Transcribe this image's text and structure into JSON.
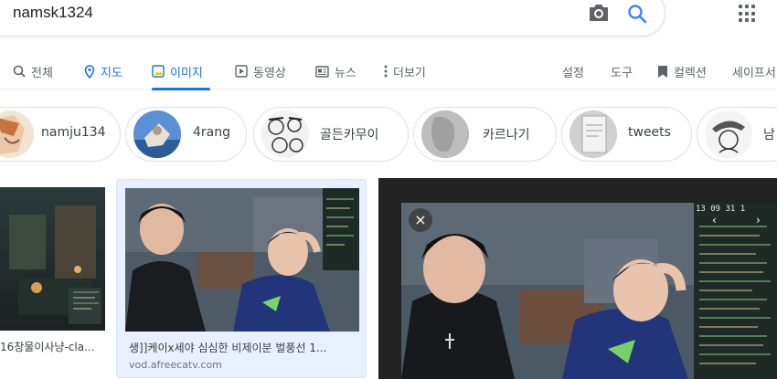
{
  "search": {
    "query": "namsk1324"
  },
  "tabs": [
    {
      "label": "전체",
      "icon": "search-icon"
    },
    {
      "label": "지도",
      "icon": "map-pin-icon"
    },
    {
      "label": "이미지",
      "icon": "image-icon",
      "active": true
    },
    {
      "label": "동영상",
      "icon": "video-icon"
    },
    {
      "label": "뉴스",
      "icon": "news-icon"
    },
    {
      "label": "더보기",
      "icon": "more-vert-icon"
    }
  ],
  "tools": {
    "settings": "설정",
    "tools": "도구",
    "collection": "컬렉션",
    "safesearch": "세이프서"
  },
  "chips": [
    "namju134",
    "4rang",
    "골든카무이",
    "카르나기",
    "tweets",
    "남"
  ],
  "results": {
    "left": {
      "title": "16창물이사냥-cla..."
    },
    "middle": {
      "title": "생]]케이x세야 심심한 비제이분 벌풍선 1...",
      "source": "vod.afreecatv.com"
    },
    "preview": {
      "close_icon": "×",
      "overlay_numbers": "13  09  31  1"
    }
  },
  "colors": {
    "accent": "#1a73e8",
    "chip_border": "#dfe1e5",
    "selected_bg": "#e8f0fe",
    "preview_bg": "#222222"
  }
}
